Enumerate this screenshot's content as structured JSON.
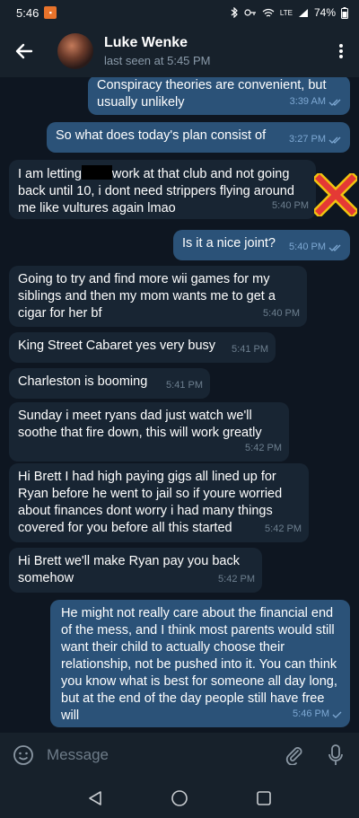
{
  "status_bar": {
    "time": "5:46",
    "network": "LTE",
    "battery": "74%"
  },
  "header": {
    "contact_name": "Luke Wenke",
    "last_seen": "last seen at 5:45 PM"
  },
  "messages": [
    {
      "dir": "out",
      "text": "Conspiracy theories are convenient, but usually unlikely",
      "time": "3:39 AM",
      "read": true
    },
    {
      "dir": "out",
      "text": "So what does today's plan consist of",
      "time": "3:27 PM",
      "read": true
    },
    {
      "dir": "in",
      "text_before": "I am letting",
      "text_after": "work at that club and not going back until 10, i dont need strippers flying around me like vultures again lmao",
      "time": "5:40 PM",
      "redacted": true
    },
    {
      "dir": "out",
      "text": "Is it a nice joint?",
      "time": "5:40 PM",
      "read": true
    },
    {
      "dir": "in",
      "text": "Going to try and find more wii games for my siblings and then my mom wants me to get a cigar for her bf",
      "time": "5:40 PM"
    },
    {
      "dir": "in",
      "text": "King Street Cabaret yes very busy",
      "time": "5:41 PM"
    },
    {
      "dir": "in",
      "text": "Charleston is booming",
      "time": "5:41 PM"
    },
    {
      "dir": "in",
      "text": "Sunday i meet ryans dad just watch we'll soothe that fire down, this will work greatly",
      "time": "5:42 PM"
    },
    {
      "dir": "in",
      "text": "Hi Brett I had high paying gigs all lined up for Ryan before he went to jail so if youre worried about finances dont worry i had many things covered for you before all this started",
      "time": "5:42 PM"
    },
    {
      "dir": "in",
      "text": "Hi Brett we'll make Ryan pay you back somehow",
      "time": "5:42 PM"
    },
    {
      "dir": "out",
      "text": "He might not really care about the financial end of the mess, and I think most parents would still want their child to actually choose their relationship, not be pushed into it. You can think you know what is best for someone all day long, but at the end of the day people still have free will",
      "time": "5:46 PM",
      "read": false
    }
  ],
  "input": {
    "placeholder": "Message"
  },
  "colors": {
    "background": "#0e1621",
    "bar": "#17212b",
    "incoming_bubble": "#182533",
    "outgoing_bubble": "#2b5278",
    "annotation_x": "#e53935"
  },
  "icons": {
    "back": "arrow-left-icon",
    "menu": "more-vertical-icon",
    "emoji": "smiley-icon",
    "attach": "paperclip-icon",
    "mic": "microphone-icon",
    "annotation": "red-x-icon"
  }
}
